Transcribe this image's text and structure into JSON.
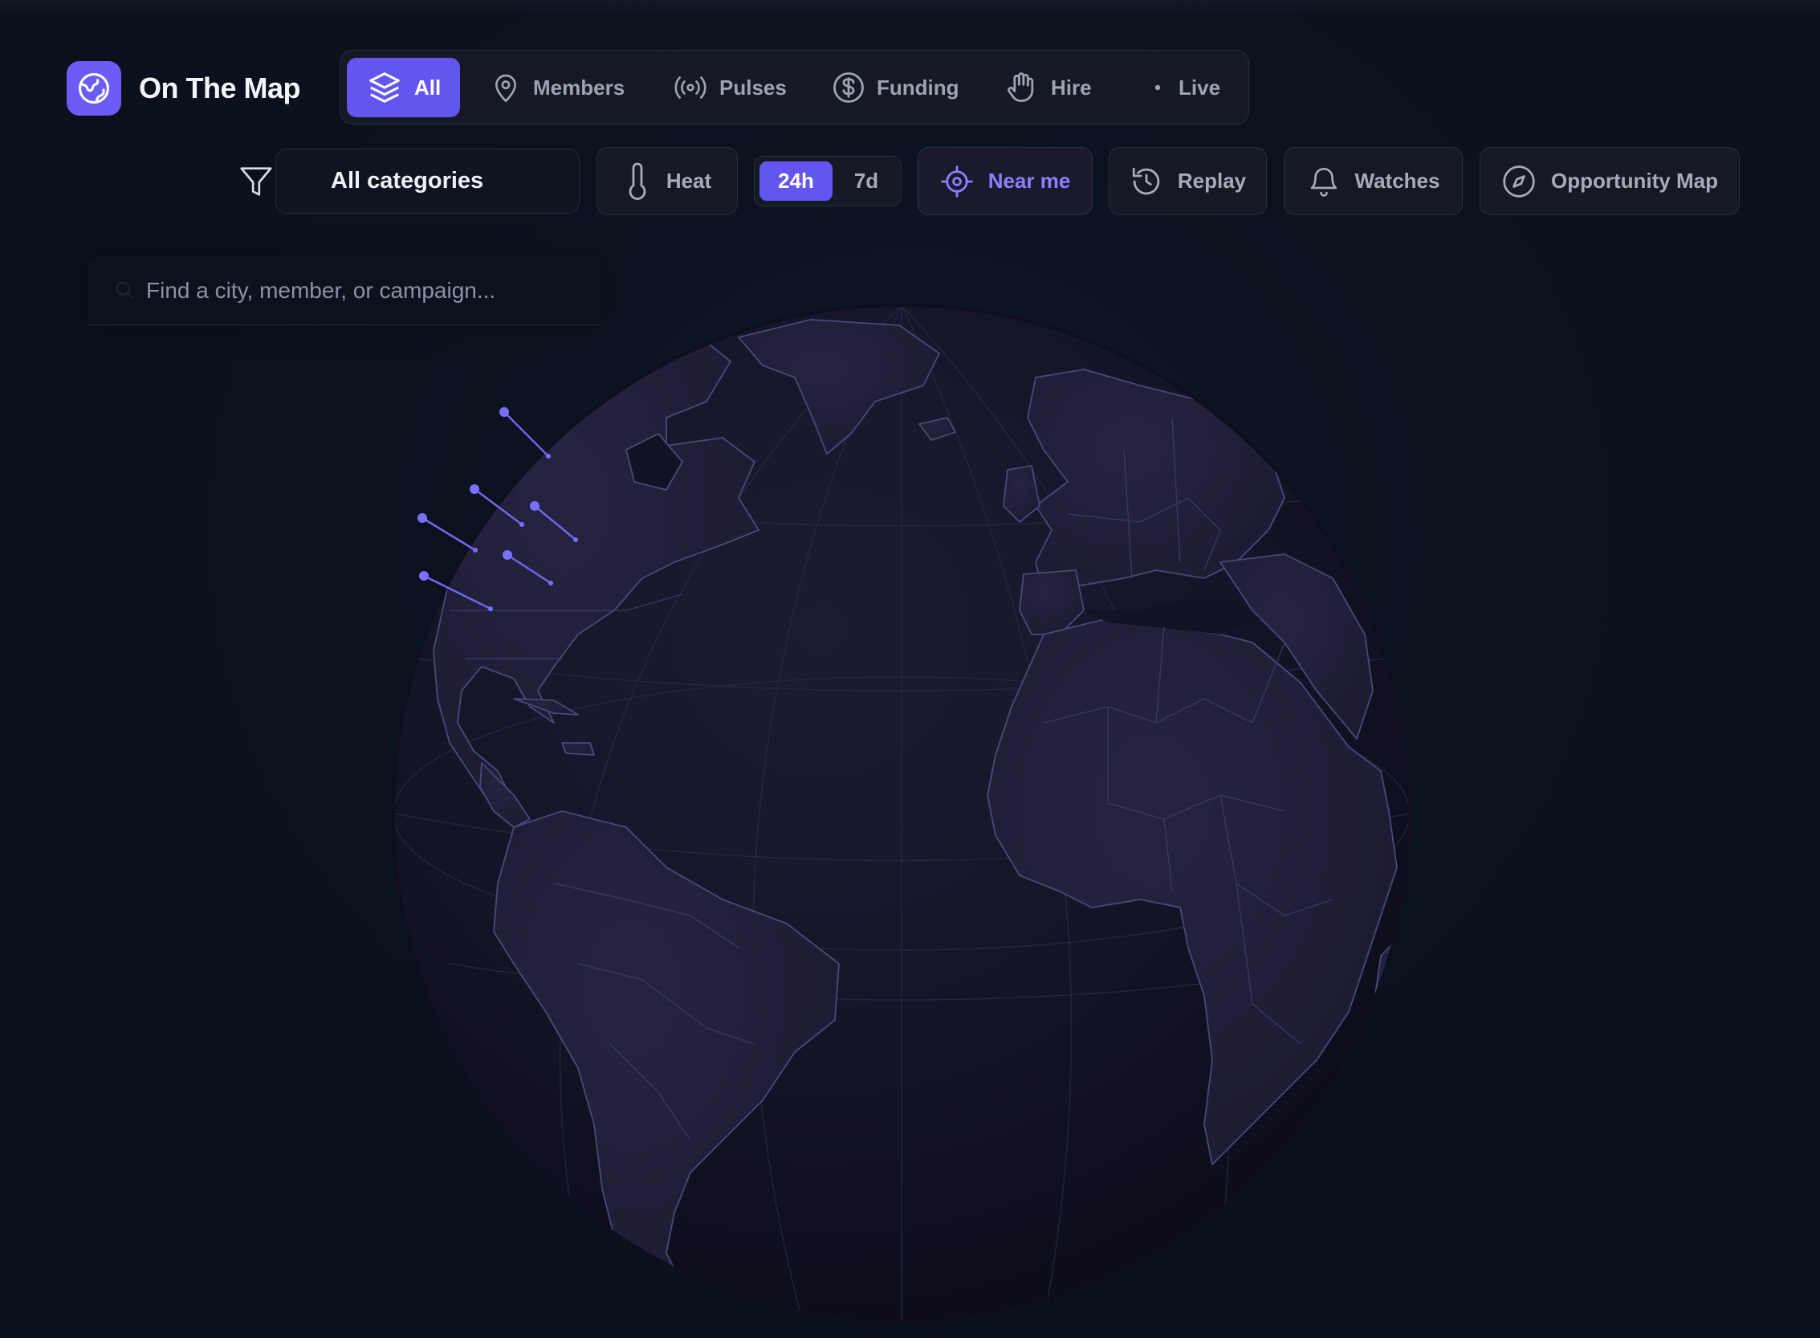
{
  "app": {
    "title": "On The Map",
    "accent_color": "#6356ef"
  },
  "layers": {
    "tabs": [
      {
        "label": "All",
        "icon": "layers-icon",
        "active": true
      },
      {
        "label": "Members",
        "icon": "map-pin-icon",
        "active": false
      },
      {
        "label": "Pulses",
        "icon": "broadcast-icon",
        "active": false
      },
      {
        "label": "Funding",
        "icon": "dollar-icon",
        "active": false
      },
      {
        "label": "Hire",
        "icon": "hand-icon",
        "active": false
      },
      {
        "label": "Live",
        "icon": "dot-icon",
        "active": false
      }
    ]
  },
  "filters": {
    "category_value": "All categories",
    "heat_label": "Heat",
    "range": {
      "options": [
        "24h",
        "7d"
      ],
      "selected": "24h"
    },
    "near_me_label": "Near me",
    "replay_label": "Replay",
    "watches_label": "Watches",
    "opportunity_label": "Opportunity Map"
  },
  "search": {
    "placeholder": "Find a city, member, or campaign..."
  },
  "map": {
    "projection": "orthographic globe",
    "center": "Atlantic Ocean",
    "pin_color": "#7066f0",
    "pins": [
      {
        "lon": -115,
        "lat": 52
      },
      {
        "lon": -100,
        "lat": 48
      },
      {
        "lon": -88,
        "lat": 45
      },
      {
        "lon": -112,
        "lat": 45
      },
      {
        "lon": -96,
        "lat": 41
      },
      {
        "lon": -107,
        "lat": 38
      }
    ]
  }
}
